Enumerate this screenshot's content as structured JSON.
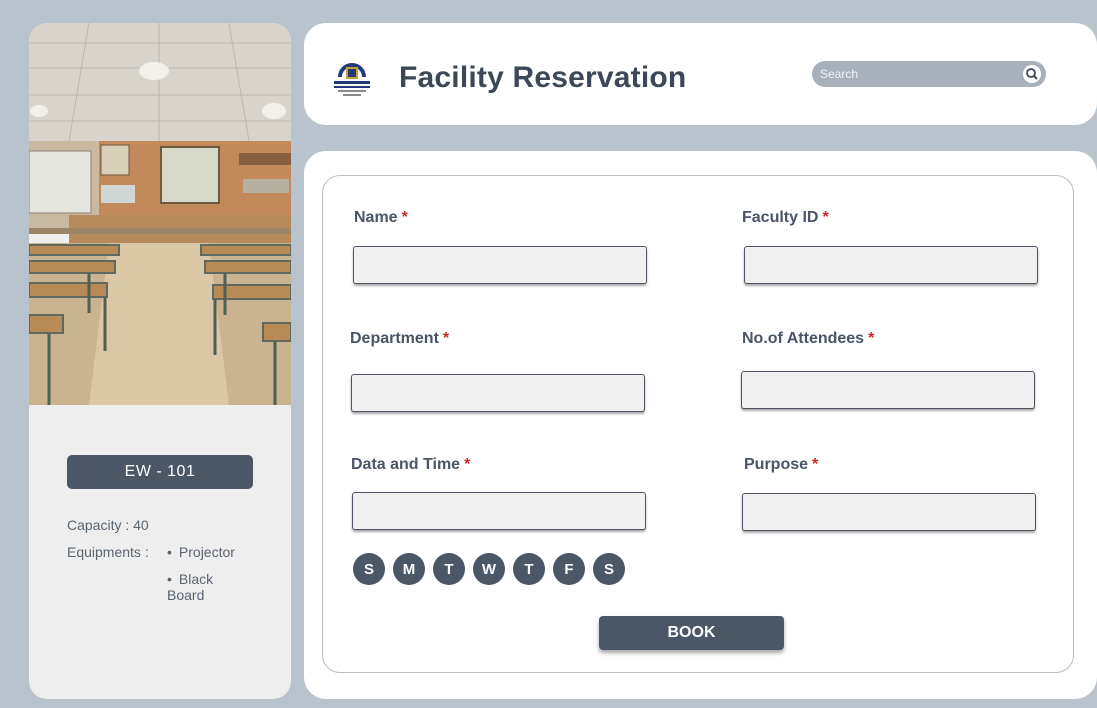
{
  "header": {
    "title": "Facility Reservation",
    "search": {
      "placeholder": "Search",
      "value": ""
    }
  },
  "room": {
    "name": "EW - 101",
    "capacity_label": "Capacity : 40",
    "equipments_label": "Equipments :",
    "equipments": [
      "Projector",
      "Black Board"
    ]
  },
  "form": {
    "fields": [
      {
        "label": "Name",
        "required_mark": "*",
        "value": ""
      },
      {
        "label": "Faculty ID",
        "required_mark": "*",
        "value": ""
      },
      {
        "label": "Department",
        "required_mark": "*",
        "value": ""
      },
      {
        "label": "No.of Attendees",
        "required_mark": "*",
        "value": ""
      },
      {
        "label": "Data and Time",
        "required_mark": "*",
        "value": ""
      },
      {
        "label": "Purpose",
        "required_mark": "*",
        "value": ""
      }
    ],
    "days": [
      "S",
      "M",
      "T",
      "W",
      "T",
      "F",
      "S"
    ],
    "submit_label": "BOOK"
  },
  "colors": {
    "background": "#b9c3cd",
    "accent": "#4b5767",
    "required": "#d0262b"
  }
}
